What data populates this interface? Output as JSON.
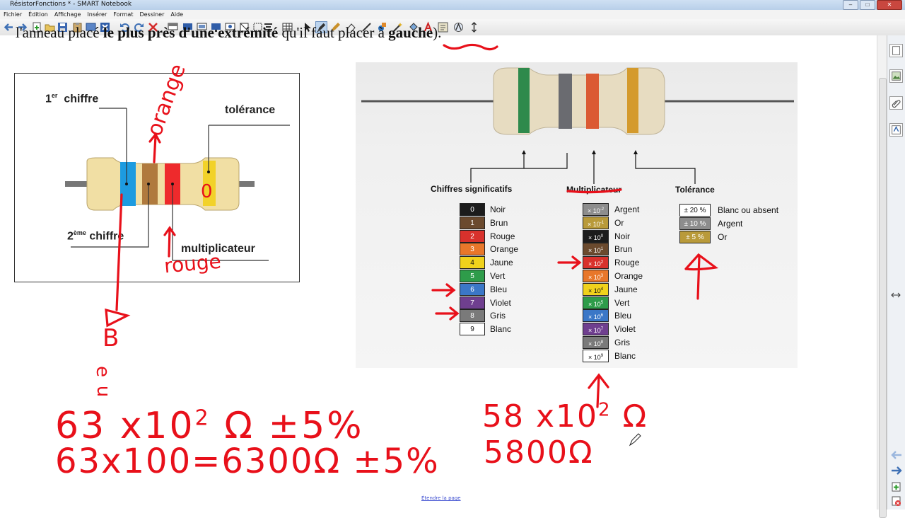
{
  "window": {
    "title": "RésistorFonctions * - SMART Notebook"
  },
  "menu": [
    "Fichier",
    "Édition",
    "Affichage",
    "Insérer",
    "Format",
    "Dessiner",
    "Aide"
  ],
  "top_text": {
    "normal1": "l'anneau placé ",
    "bold1": "le plus près d'une extrémité",
    "normal2": " qu'il faut placer à ",
    "bold2": "gauche",
    "end": ")."
  },
  "left_diagram": {
    "first_digit": {
      "num": "1",
      "sup": "er",
      "word": "chiffre"
    },
    "tolerance": "tolérance",
    "second_digit": {
      "num": "2",
      "sup": "ème",
      "word": "chiffre"
    },
    "multiplier": "multiplicateur"
  },
  "table": {
    "significant_title": "Chiffres significatifs",
    "multiplier_title": "Multiplicateur",
    "tolerance_title": "Tolérance",
    "digits": [
      {
        "value": "0",
        "name": "Noir",
        "color": "#1c1c1c"
      },
      {
        "value": "1",
        "name": "Brun",
        "color": "#6b4a2e"
      },
      {
        "value": "2",
        "name": "Rouge",
        "color": "#d8312c"
      },
      {
        "value": "3",
        "name": "Orange",
        "color": "#e8772a"
      },
      {
        "value": "4",
        "name": "Jaune",
        "color": "#f0d21c"
      },
      {
        "value": "5",
        "name": "Vert",
        "color": "#2e9c4a"
      },
      {
        "value": "6",
        "name": "Bleu",
        "color": "#3b77c7"
      },
      {
        "value": "7",
        "name": "Violet",
        "color": "#6f3f8f"
      },
      {
        "value": "8",
        "name": "Gris",
        "color": "#7a7a7a"
      },
      {
        "value": "9",
        "name": "Blanc",
        "color": "#ffffff"
      }
    ],
    "multipliers": [
      {
        "base": "× 10",
        "exp": "-2",
        "name": "Argent",
        "color": "#8d8d8d"
      },
      {
        "base": "× 10",
        "exp": "-1",
        "name": "Or",
        "color": "#b99a3a"
      },
      {
        "base": "× 10",
        "exp": "0",
        "name": "Noir",
        "color": "#1c1c1c"
      },
      {
        "base": "× 10",
        "exp": "1",
        "name": "Brun",
        "color": "#6b4a2e"
      },
      {
        "base": "× 10",
        "exp": "2",
        "name": "Rouge",
        "color": "#d8312c"
      },
      {
        "base": "× 10",
        "exp": "3",
        "name": "Orange",
        "color": "#e8772a"
      },
      {
        "base": "× 10",
        "exp": "4",
        "name": "Jaune",
        "color": "#f0d21c"
      },
      {
        "base": "× 10",
        "exp": "5",
        "name": "Vert",
        "color": "#2e9c4a"
      },
      {
        "base": "× 10",
        "exp": "6",
        "name": "Bleu",
        "color": "#3b77c7"
      },
      {
        "base": "× 10",
        "exp": "7",
        "name": "Violet",
        "color": "#6f3f8f"
      },
      {
        "base": "× 10",
        "exp": "8",
        "name": "Gris",
        "color": "#7a7a7a"
      },
      {
        "base": "× 10",
        "exp": "9",
        "name": "Blanc",
        "color": "#ffffff"
      }
    ],
    "tolerances": [
      {
        "value": "± 20 %",
        "name": "Blanc ou absent",
        "color": "#ffffff"
      },
      {
        "value": "± 10 %",
        "name": "Argent",
        "color": "#8d8d8d"
      },
      {
        "value": "± 5 %",
        "name": "Or",
        "color": "#b99a3a"
      }
    ]
  },
  "handwriting": {
    "orange": "orange",
    "zero": "0",
    "rouge": "rouge",
    "b": "B",
    "e": "e",
    "u": "u",
    "line1_a": "63 x10",
    "line1_exp": "2",
    "line1_b": "Ω ±5%",
    "line2": "63x100=6300Ω ±5%",
    "line3_a": "58 x10",
    "line3_exp": "2",
    "line3_b": "Ω",
    "line4": "5800Ω"
  },
  "footer": {
    "link": "Étendre la page"
  },
  "accent": "#e8101a"
}
